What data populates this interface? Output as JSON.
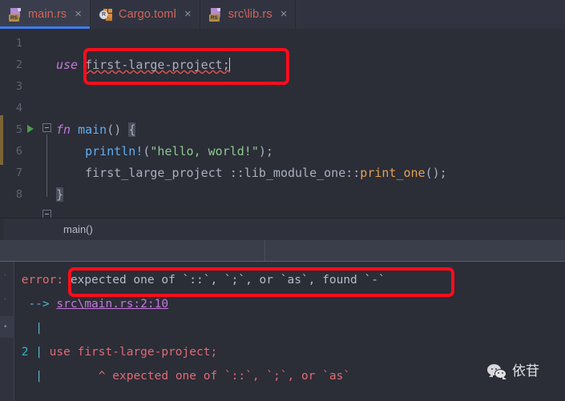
{
  "tabs": [
    {
      "label": "main.rs",
      "icon": "rust-file-icon",
      "badge": "RS",
      "active": true,
      "close": "×"
    },
    {
      "label": "Cargo.toml",
      "icon": "cargo-toml-icon",
      "badge": "",
      "active": false,
      "close": "×"
    },
    {
      "label": "src\\lib.rs",
      "icon": "rust-file-icon",
      "badge": "RS",
      "active": false,
      "close": "×"
    }
  ],
  "editor": {
    "line_numbers": [
      "1",
      "2",
      "3",
      "4",
      "5",
      "6",
      "7",
      "8"
    ],
    "lines": [
      {
        "n": "1",
        "text": ""
      },
      {
        "n": "2",
        "kw": "use",
        "name": "first-large-project",
        "semi": ";"
      },
      {
        "n": "3",
        "text": ""
      },
      {
        "n": "4",
        "text": ""
      },
      {
        "n": "5",
        "kw": "fn",
        "fn_name": "main",
        "parens": "()",
        "brace": "{"
      },
      {
        "n": "6",
        "macro": "println!",
        "str": "\"hello, world!\"",
        "tail": ");"
      },
      {
        "n": "7",
        "path": "first_large_project ::lib_module_one::",
        "call": "print_one",
        "tail": "();"
      },
      {
        "n": "8",
        "brace": "}"
      }
    ],
    "run_marker_line": "5",
    "gutter_icons": {
      "run": "run-triangle-icon",
      "fold_open": "fold-open-icon",
      "fold_close": "fold-close-icon"
    }
  },
  "breadcrumb": {
    "text": "main()"
  },
  "console": {
    "error_label": "error:",
    "error_message": "expected one of `::`, `;`, or `as`, found `-`",
    "arrow": "-->",
    "location": "src\\main.rs:2:10",
    "bar": "|",
    "snippet_line_number": "2",
    "snippet_code": "use first-large-project;",
    "caret_marker": "^",
    "caret_message": "expected one of `::`, `;`, or `as`",
    "gutter_icons": [
      "warn-dot-icon",
      "warn-dot-icon",
      "wrench-icon"
    ]
  },
  "annotations": [
    {
      "name": "code-highlight-box",
      "color": "#fc0d1b"
    },
    {
      "name": "error-highlight-box",
      "color": "#fc0d1b"
    }
  ],
  "watermark": {
    "icon": "wechat-logo-icon",
    "text": "依苷"
  },
  "colors": {
    "bg_editor": "#2b2d37",
    "bg_tabbar": "#313440",
    "tab_active": "#3a3e4c",
    "tab_label": "#d0655b",
    "accent_underline": "#3d7cf2",
    "keyword": "#c678dd",
    "function": "#61afef",
    "string": "#8cc98f",
    "orange": "#e5a050",
    "error_red": "#e06c75",
    "squiggle": "#d8524a",
    "link": "#c678dd",
    "cyan": "#56b6c2",
    "annotation": "#fc0d1b"
  }
}
